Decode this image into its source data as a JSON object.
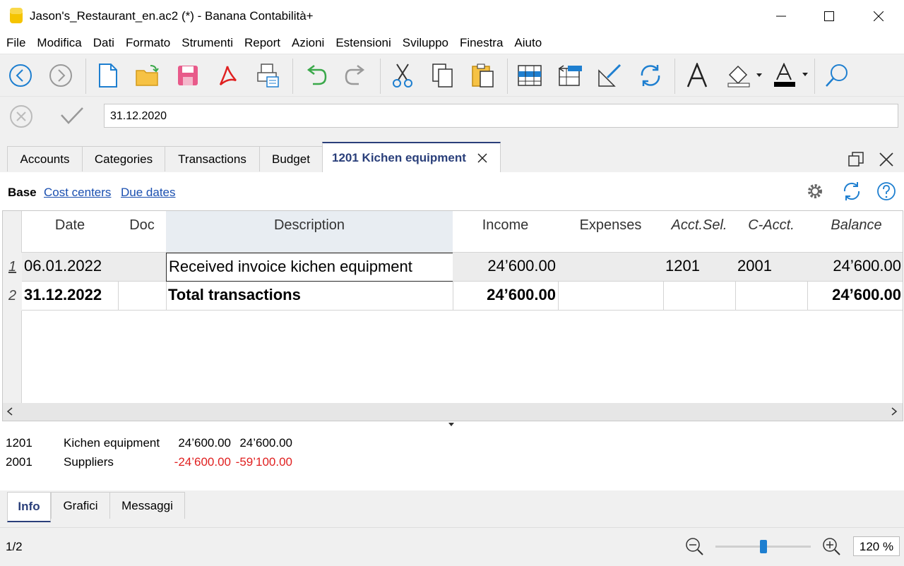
{
  "window": {
    "title": "Jason's_Restaurant_en.ac2 (*) - Banana Contabilità+"
  },
  "menu": [
    "File",
    "Modifica",
    "Dati",
    "Formato",
    "Strumenti",
    "Report",
    "Azioni",
    "Estensioni",
    "Sviluppo",
    "Finestra",
    "Aiuto"
  ],
  "editor": {
    "value": "31.12.2020"
  },
  "tabs": {
    "accounts": "Accounts",
    "categories": "Categories",
    "transactions": "Transactions",
    "budget": "Budget",
    "active": "1201 Kichen equipment"
  },
  "views": {
    "base": "Base",
    "cost_centers": "Cost centers",
    "due_dates": "Due dates"
  },
  "columns": {
    "date": "Date",
    "doc": "Doc",
    "description": "Description",
    "income": "Income",
    "expenses": "Expenses",
    "acct_sel": "Acct.Sel.",
    "c_acct": "C-Acct.",
    "balance": "Balance"
  },
  "rows": [
    {
      "num": "1",
      "date": "06.01.2022",
      "doc": "",
      "description": "Received invoice kichen equipment",
      "income": "24’600.00",
      "expenses": "",
      "acct_sel": "1201",
      "c_acct": "2001",
      "balance": "24’600.00"
    },
    {
      "num": "2",
      "date": "31.12.2022",
      "doc": "",
      "description": "Total transactions",
      "income": "24’600.00",
      "expenses": "",
      "acct_sel": "",
      "c_acct": "",
      "balance": "24’600.00"
    }
  ],
  "info": [
    {
      "account": "1201",
      "name": "Kichen equipment",
      "amount": "24’600.00",
      "balance": "24’600.00"
    },
    {
      "account": "2001",
      "name": "Suppliers",
      "amount": "-24’600.00",
      "balance": "-59’100.00"
    }
  ],
  "bottom_tabs": {
    "info": "Info",
    "grafici": "Grafici",
    "messaggi": "Messaggi"
  },
  "status": {
    "page": "1/2",
    "zoom": "120 %",
    "zoom_level": 0.5
  },
  "colors": {
    "accent": "#2a3f7a",
    "link": "#1a4fb0",
    "negative": "#e02020",
    "icon_blue": "#1e7fd0"
  }
}
